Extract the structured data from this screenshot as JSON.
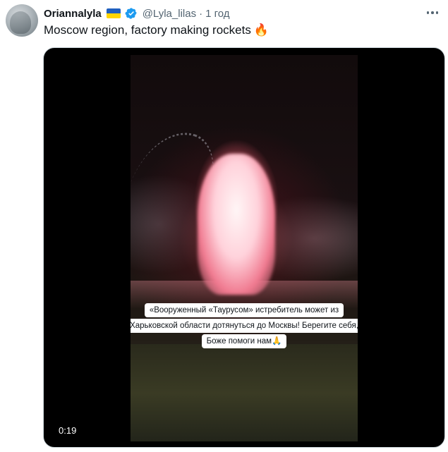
{
  "tweet": {
    "display_name": "Oriannalyla",
    "flag_colors": {
      "top": "#1f5fbf",
      "bottom": "#ffd500"
    },
    "verified_color": "#1d9bf0",
    "handle": "@Lyla_lilas",
    "separator": "·",
    "time": "1 год",
    "text": "Moscow region, factory making rockets",
    "emoji": "🔥",
    "more_icon": "more-horizontal-icon"
  },
  "media": {
    "type": "video",
    "duration": "0:19",
    "caption_lines": [
      "«Вооруженный «Таурусом» истребитель может из",
      "Харьковской области дотянуться до Москвы! Берегите себя,",
      "Боже помоги нам🙏"
    ]
  }
}
